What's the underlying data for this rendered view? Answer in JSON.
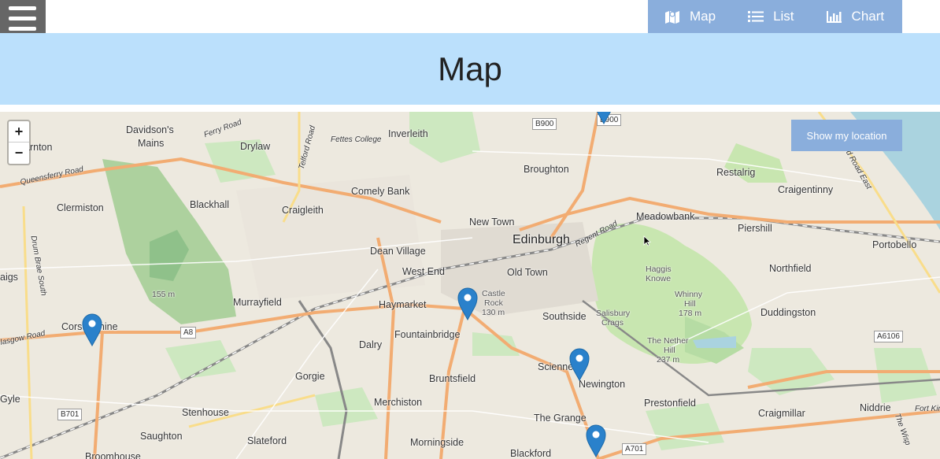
{
  "nav": {
    "items": [
      {
        "label": "Map",
        "icon": "map-icon"
      },
      {
        "label": "List",
        "icon": "list-icon"
      },
      {
        "label": "Chart",
        "icon": "chart-icon"
      }
    ]
  },
  "header": {
    "title": "Map"
  },
  "map": {
    "zoom_in": "+",
    "zoom_out": "−",
    "locate_button": "Show my location",
    "places": [
      "Davidson's",
      "Mains",
      "Drylaw",
      "Inverleith",
      "Broughton",
      "Restalrig",
      "Craigentinny",
      "Comely Bank",
      "Clermiston",
      "Blackhall",
      "Craigleith",
      "New Town",
      "Edinburgh",
      "Meadowbank",
      "Piershill",
      "Portobello",
      "Dean Village",
      "West End",
      "Old Town",
      "Haggis Knowe",
      "Northfield",
      "Murrayfield",
      "Haymarket",
      "Castle",
      "Rock",
      "130 m",
      "Southside",
      "Salisbury",
      "Crags",
      "Whinny",
      "Hill",
      "178 m",
      "Duddingston",
      "Corstorphine",
      "Dalry",
      "Fountainbridge",
      "The Nether",
      "Hill",
      "237 m",
      "Sciennes",
      "Newington",
      "Gorgie",
      "Bruntsfield",
      "Prestonfield",
      "Merchiston",
      "Stenhouse",
      "The Grange",
      "Craigmillar",
      "Niddrie",
      "Saughton",
      "Slateford",
      "Morningside",
      "Blackford",
      "Broomhouse",
      "arnton",
      "aigs",
      "Gyle",
      "155 m",
      "Fettes College",
      "Ferry Road",
      "Queensferry Road",
      "Telford Road",
      "Regent Road",
      "Drum Brae South",
      "lasgow Road",
      "Fort Kin",
      "The Wisp",
      "Seafield Road East"
    ],
    "roads": [
      "B900",
      "B900",
      "A8",
      "B701",
      "A6106",
      "A701"
    ],
    "marker_count": 5
  }
}
